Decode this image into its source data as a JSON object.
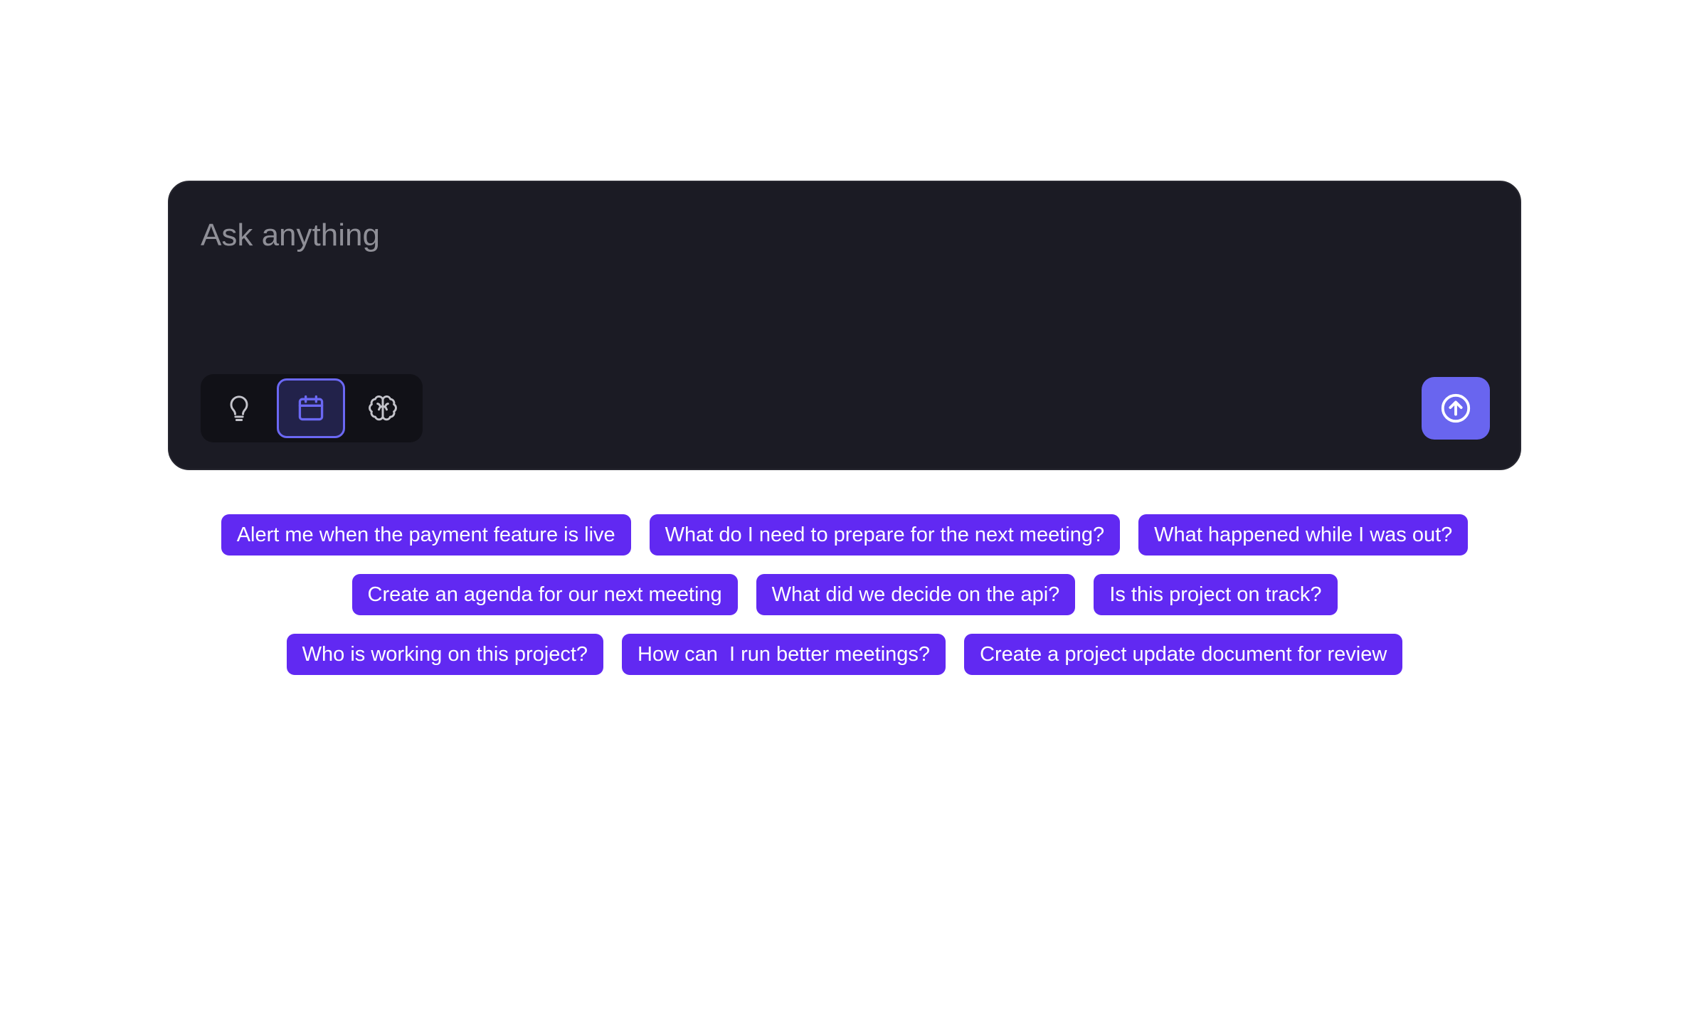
{
  "composer": {
    "placeholder": "Ask anything",
    "value": ""
  },
  "modes": [
    {
      "name": "idea",
      "icon": "lightbulb-icon",
      "selected": false
    },
    {
      "name": "calendar",
      "icon": "calendar-icon",
      "selected": true
    },
    {
      "name": "brain",
      "icon": "brain-icon",
      "selected": false
    }
  ],
  "send": {
    "icon": "arrow-up-circle-icon"
  },
  "suggestions": {
    "row1": [
      "Alert me when the payment feature is live",
      "What do I need to prepare for the next meeting?",
      "What happened while I was out?"
    ],
    "row2": [
      "Create an agenda for our next meeting",
      "What did we decide on the api?",
      "Is this project on track?"
    ],
    "row3": [
      "Who is working on this project?",
      "How can  I run better meetings?",
      "Create a project update document for review"
    ]
  },
  "colors": {
    "composer_bg": "#1b1b24",
    "accent": "#6965ef",
    "chip_bg": "#6129f2",
    "selected_mode_border": "#6b68f4"
  }
}
